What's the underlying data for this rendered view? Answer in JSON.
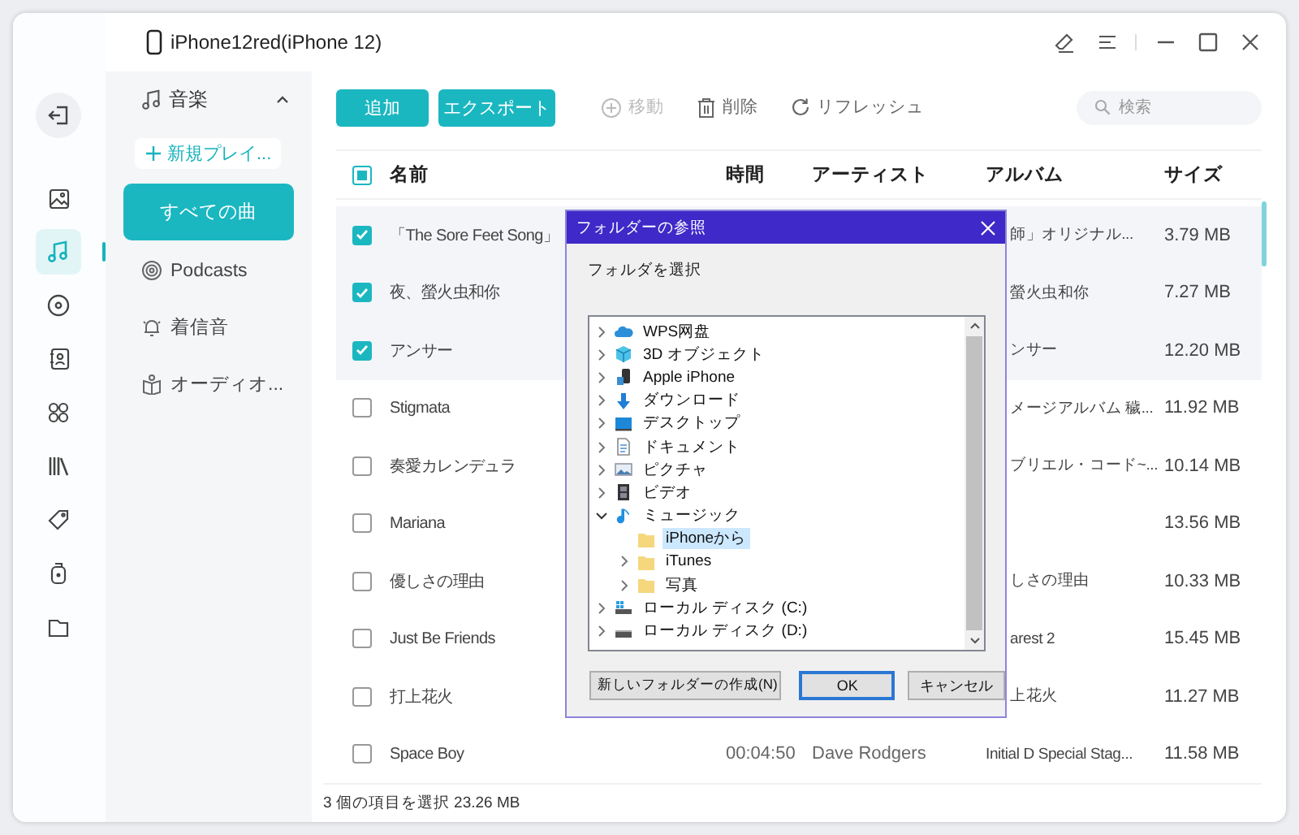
{
  "window": {
    "title": "iPhone12red(iPhone 12)"
  },
  "rail": [
    {
      "kind": "photos",
      "selected": false
    },
    {
      "kind": "music",
      "selected": true
    },
    {
      "kind": "disc",
      "selected": false
    },
    {
      "kind": "contacts",
      "selected": false
    },
    {
      "kind": "apps",
      "selected": false
    },
    {
      "kind": "books",
      "selected": false
    },
    {
      "kind": "tag",
      "selected": false
    },
    {
      "kind": "device",
      "selected": false
    },
    {
      "kind": "folder",
      "selected": false
    }
  ],
  "sidebar": {
    "section": {
      "label": "音楽",
      "expanded": true
    },
    "new_playlist": "新規プレイ...",
    "items": [
      {
        "label": "すべての曲",
        "kind": "all",
        "selected": true
      },
      {
        "label": "Podcasts",
        "kind": "podcast",
        "selected": false
      },
      {
        "label": "着信音",
        "kind": "ringtone",
        "selected": false
      },
      {
        "label": "オーディオ...",
        "kind": "audiobook",
        "selected": false
      }
    ]
  },
  "toolbar": {
    "buttons": [
      {
        "label": "追加",
        "kind": "primary",
        "disabled": false
      },
      {
        "label": "エクスポート",
        "kind": "primary",
        "disabled": false
      },
      {
        "label": "移動",
        "kind": "move",
        "disabled": true
      },
      {
        "label": "削除",
        "kind": "delete",
        "disabled": false
      },
      {
        "label": "リフレッシュ",
        "kind": "refresh",
        "disabled": false
      }
    ],
    "search": {
      "placeholder": "検索"
    }
  },
  "table": {
    "select_all_partial": true,
    "columns": [
      "名前",
      "時間",
      "アーティスト",
      "アルバム",
      "サイズ"
    ],
    "rows": [
      {
        "name": "「The Sore Feet Song」",
        "album": "師」オリジナル...",
        "size": "3.79 MB",
        "checked": true
      },
      {
        "name": "夜、螢火虫和你",
        "album": "螢火虫和你",
        "size": "7.27 MB",
        "checked": true
      },
      {
        "name": "アンサー",
        "album": "ンサー",
        "size": "12.20 MB",
        "checked": true
      },
      {
        "name": "Stigmata",
        "album": "メージアルバム 穢...",
        "size": "11.92 MB",
        "checked": false
      },
      {
        "name": "奏愛カレンデュラ",
        "album": "ブリエル・コード~...",
        "size": "10.14 MB",
        "checked": false
      },
      {
        "name": "Mariana",
        "size": "13.56 MB",
        "checked": false
      },
      {
        "name": "優しさの理由",
        "album": "しさの理由",
        "size": "10.33 MB",
        "checked": false
      },
      {
        "name": "Just Be Friends",
        "album": "arest 2",
        "size": "15.45 MB",
        "checked": false
      },
      {
        "name": "打上花火",
        "album": "上花火",
        "size": "11.27 MB",
        "checked": false
      },
      {
        "name": "Space Boy",
        "time": "00:04:50",
        "artist": "Dave Rodgers",
        "album": "Initial D Special Stag...",
        "size": "11.58 MB",
        "checked": false
      }
    ]
  },
  "status_bar": "3 個の項目を選択 23.26 MB",
  "dialog": {
    "title": "フォルダーの参照",
    "prompt": "フォルダを選択",
    "tree": [
      {
        "label": "WPS网盘",
        "kind": "cloud",
        "expandable": true,
        "expanded": false,
        "selected": false
      },
      {
        "label": "3D オブジェクト",
        "kind": "cube",
        "expandable": true,
        "expanded": false,
        "selected": false
      },
      {
        "label": "Apple iPhone",
        "kind": "phone",
        "expandable": true,
        "expanded": false,
        "selected": false
      },
      {
        "label": "ダウンロード",
        "kind": "download",
        "expandable": true,
        "expanded": false,
        "selected": false
      },
      {
        "label": "デスクトップ",
        "kind": "desktop",
        "expandable": true,
        "expanded": false,
        "selected": false
      },
      {
        "label": "ドキュメント",
        "kind": "document",
        "expandable": true,
        "expanded": false,
        "selected": false
      },
      {
        "label": "ピクチャ",
        "kind": "pictures",
        "expandable": true,
        "expanded": false,
        "selected": false
      },
      {
        "label": "ビデオ",
        "kind": "video",
        "expandable": true,
        "expanded": false,
        "selected": false
      },
      {
        "label": "ミュージック",
        "kind": "music",
        "expandable": true,
        "expanded": true,
        "selected": false,
        "children": [
          {
            "label": "iPhoneから",
            "kind": "folder",
            "expandable": false,
            "selected": true
          },
          {
            "label": "iTunes",
            "kind": "folder",
            "expandable": true,
            "expanded": false,
            "selected": false
          },
          {
            "label": "写真",
            "kind": "folder",
            "expandable": true,
            "expanded": false,
            "selected": false
          }
        ]
      },
      {
        "label": "ローカル ディスク (C:)",
        "kind": "system-drive",
        "expandable": true,
        "expanded": false,
        "selected": false
      },
      {
        "label": "ローカル ディスク (D:)",
        "kind": "drive",
        "expandable": true,
        "expanded": false,
        "selected": false
      }
    ],
    "buttons": [
      {
        "label": "新しいフォルダーの作成(N)",
        "default": false
      },
      {
        "label": "OK",
        "default": true
      },
      {
        "label": "キャンセル",
        "default": false
      }
    ]
  }
}
